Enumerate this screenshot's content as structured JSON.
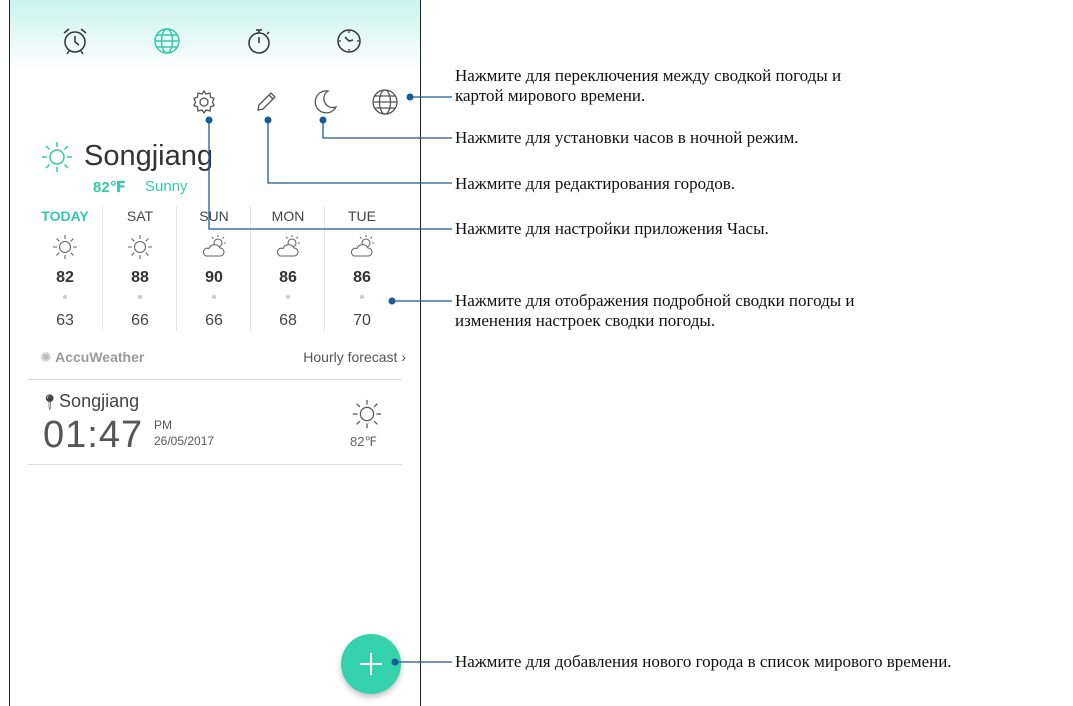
{
  "tabs": [
    {
      "name": "alarm",
      "icon": "alarm-clock-icon"
    },
    {
      "name": "world-clock",
      "icon": "globe-icon",
      "active": true
    },
    {
      "name": "timer",
      "icon": "timer-icon"
    },
    {
      "name": "stopwatch",
      "icon": "stopwatch-icon"
    }
  ],
  "toolbar": {
    "icons": [
      "gear-icon",
      "pencil-icon",
      "moon-icon",
      "globe-icon"
    ]
  },
  "weather": {
    "city": "Songjiang",
    "temp": "82℉",
    "condition": "Sunny",
    "forecast": [
      {
        "day": "TODAY",
        "high": "82",
        "low": "63",
        "icon": "sun-icon"
      },
      {
        "day": "SAT",
        "high": "88",
        "low": "66",
        "icon": "sun-icon"
      },
      {
        "day": "SUN",
        "high": "90",
        "low": "66",
        "icon": "partly-cloudy-icon"
      },
      {
        "day": "MON",
        "high": "86",
        "low": "68",
        "icon": "partly-cloudy-icon"
      },
      {
        "day": "TUE",
        "high": "86",
        "low": "70",
        "icon": "partly-cloudy-icon"
      }
    ],
    "provider": "AccuWeather",
    "hourly_link": "Hourly forecast"
  },
  "world_clock": {
    "city": "Songjiang",
    "time": "01:47",
    "ampm": "PM",
    "date": "26/05/2017",
    "temp": "82℉"
  },
  "callouts": {
    "globe_line1": "Нажмите для переключения между сводкой погоды и",
    "globe_line2": "картой мирового времени.",
    "night": "Нажмите для установки часов в ночной режим.",
    "edit": "Нажмите для редактирования городов.",
    "settings": "Нажмите для настройки приложения Часы.",
    "weather_line1": "Нажмите для отображения подробной сводки погоды и",
    "weather_line2": "изменения настроек сводки погоды.",
    "add": "Нажмите для добавления нового города в список мирового времени."
  },
  "colors": {
    "accent": "#35c9a8",
    "fab": "#35d3ad",
    "callout_line": "#1a5a96"
  }
}
